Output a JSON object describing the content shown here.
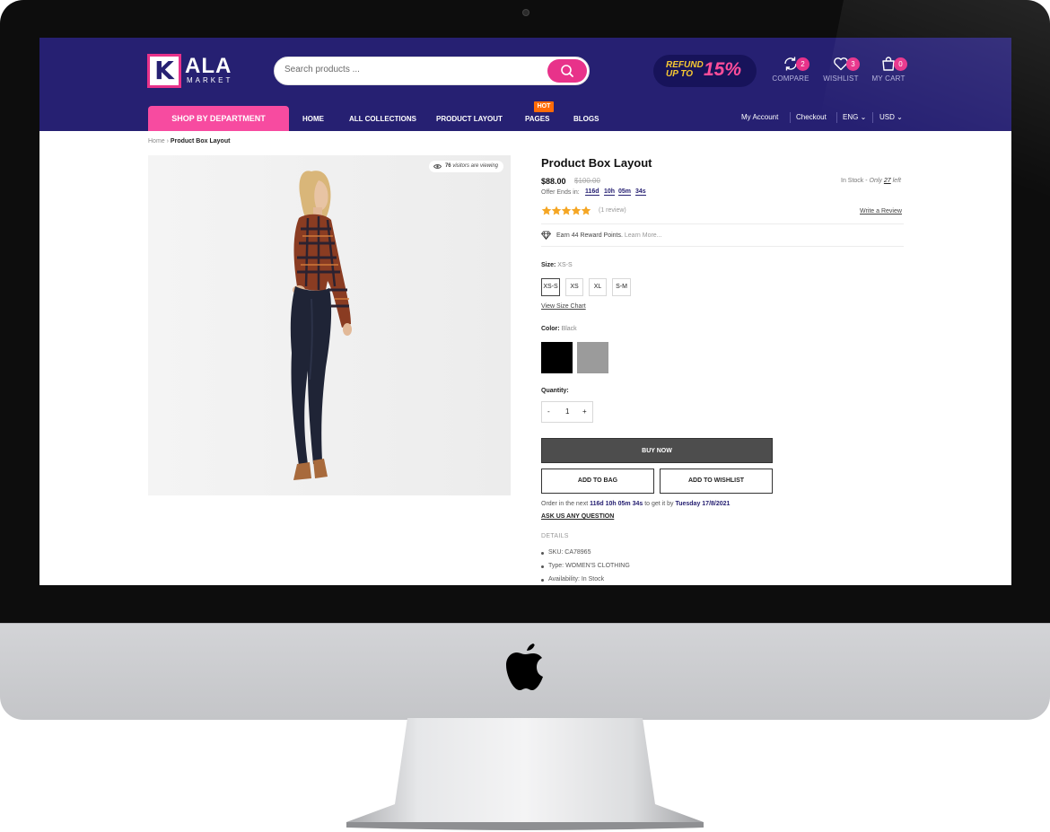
{
  "header": {
    "logo_letter": "K",
    "logo_name": "ALA",
    "logo_sub": "MARKET",
    "search_placeholder": "Search products ...",
    "promo_line1": "REFUND",
    "promo_line2": "UP TO",
    "promo_value": "15%",
    "compare_label": "COMPARE",
    "compare_count": "2",
    "wishlist_label": "WISHLIST",
    "wishlist_count": "3",
    "cart_label": "MY CART",
    "cart_count": "0"
  },
  "nav": {
    "shop_by_department": "SHOP BY DEPARTMENT",
    "items": [
      "HOME",
      "ALL COLLECTIONS",
      "PRODUCT LAYOUT",
      "PAGES",
      "BLOGS"
    ],
    "hot_badge": "HOT",
    "my_account": "My Account",
    "checkout": "Checkout",
    "language": "ENG",
    "currency": "USD"
  },
  "breadcrumb": {
    "home": "Home",
    "current": "Product Box Layout"
  },
  "product": {
    "visitors_count": "76",
    "visitors_text": "visitors are viewing",
    "title": "Product Box Layout",
    "price": "$88.00",
    "old_price": "$100.00",
    "stock_prefix": "In Stock - ",
    "stock_only": "Only",
    "stock_count": "27",
    "stock_suffix": "left",
    "offer_label": "Offer Ends in:",
    "offer_days": "116d",
    "offer_hours": "10h",
    "offer_minutes": "05m",
    "offer_seconds": "34s",
    "rating": 5,
    "review_count": "(1 review)",
    "write_review": "Write a Review",
    "reward_text": "Earn 44 Reward Points.",
    "reward_link": "Learn More...",
    "size_label": "Size:",
    "size_value": "XS-S",
    "sizes": [
      "XS-S",
      "XS",
      "XL",
      "S-M"
    ],
    "size_chart": "View Size Chart",
    "color_label": "Color:",
    "color_value": "Black",
    "colors": [
      "#000000",
      "#9b9b9b"
    ],
    "quantity_label": "Quantity:",
    "quantity_minus": "-",
    "quantity": "1",
    "quantity_plus": "+",
    "buy_now": "BUY NOW",
    "add_to_bag": "ADD TO BAG",
    "add_to_wishlist": "ADD TO WISHLIST",
    "order_prefix": "Order in the next",
    "order_time": "116d 10h 05m 34s",
    "order_mid": "to get it by",
    "order_date": "Tuesday 17/8/2021",
    "ask_question": "ASK US ANY QUESTION",
    "details_heading": "DETAILS",
    "details": [
      "SKU: CA78965",
      "Type: WOMEN'S CLOTHING",
      "Availability: In Stock"
    ]
  },
  "colors": {
    "header_bg": "#262072",
    "accent_pink": "#e8328a",
    "hot_orange": "#ff6b08",
    "star_gold": "#f5a623"
  }
}
